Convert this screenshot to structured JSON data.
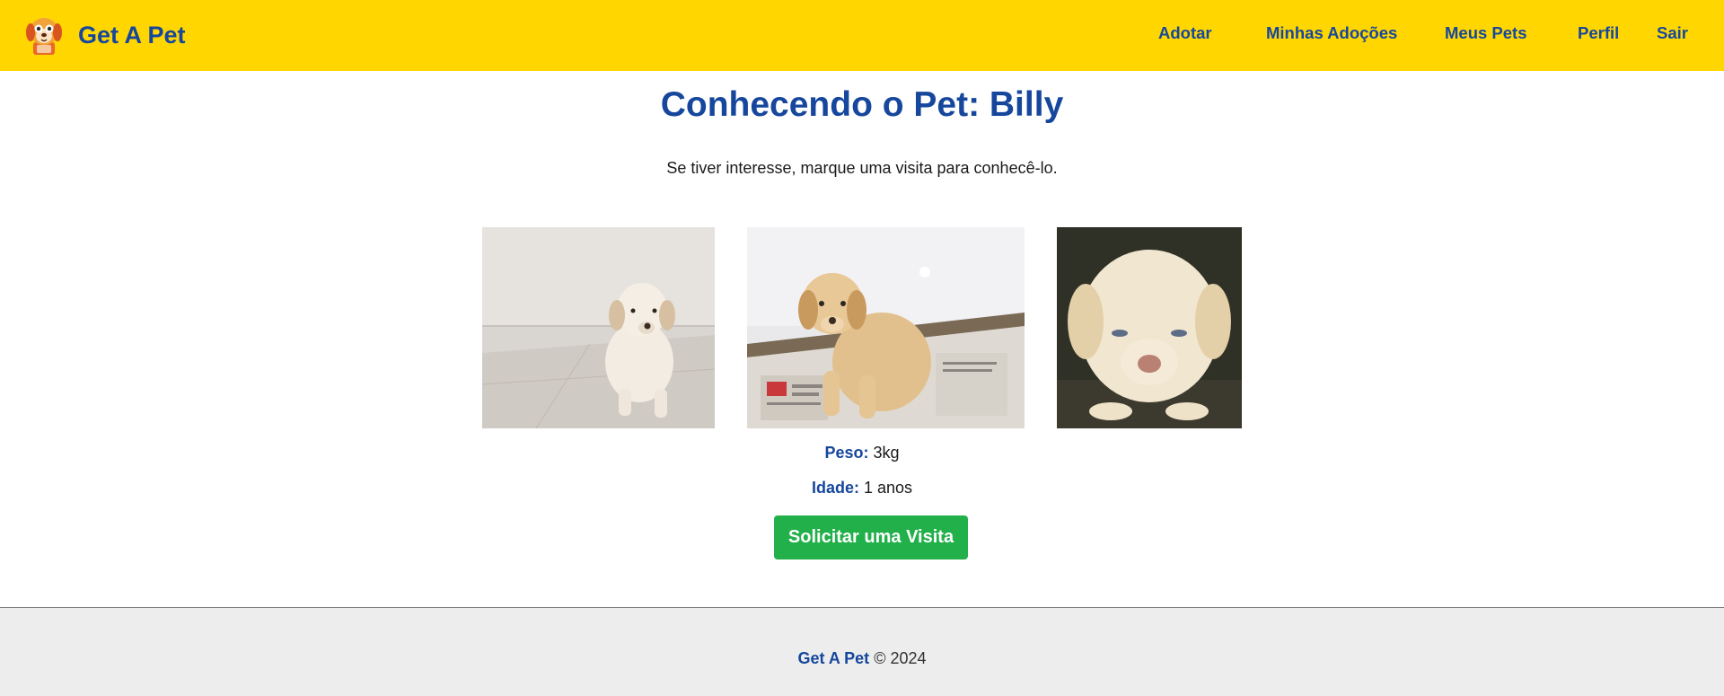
{
  "app": {
    "name": "Get A Pet",
    "logo_icon": "dog-face-icon"
  },
  "nav": {
    "links": [
      "Adotar",
      "Minhas Adoções",
      "Meus Pets",
      "Perfil",
      "Sair"
    ]
  },
  "pet": {
    "title": "Conhecendo o Pet: Billy",
    "subtitle": "Se tiver interesse, marque uma visita para conhecê-lo.",
    "weight_label": "Peso:",
    "weight_value": "3kg",
    "age_label": "Idade:",
    "age_value": "1 anos",
    "request_button": "Solicitar uma Visita",
    "photos": [
      "puppy-photo-1",
      "puppy-photo-2",
      "puppy-photo-3"
    ]
  },
  "footer": {
    "brand": "Get A Pet",
    "copyright": "© 2024"
  },
  "colors": {
    "navbar_bg": "#FFD600",
    "brand_blue": "#16479d",
    "button_green": "#22b04a",
    "footer_bg": "#ededed"
  }
}
